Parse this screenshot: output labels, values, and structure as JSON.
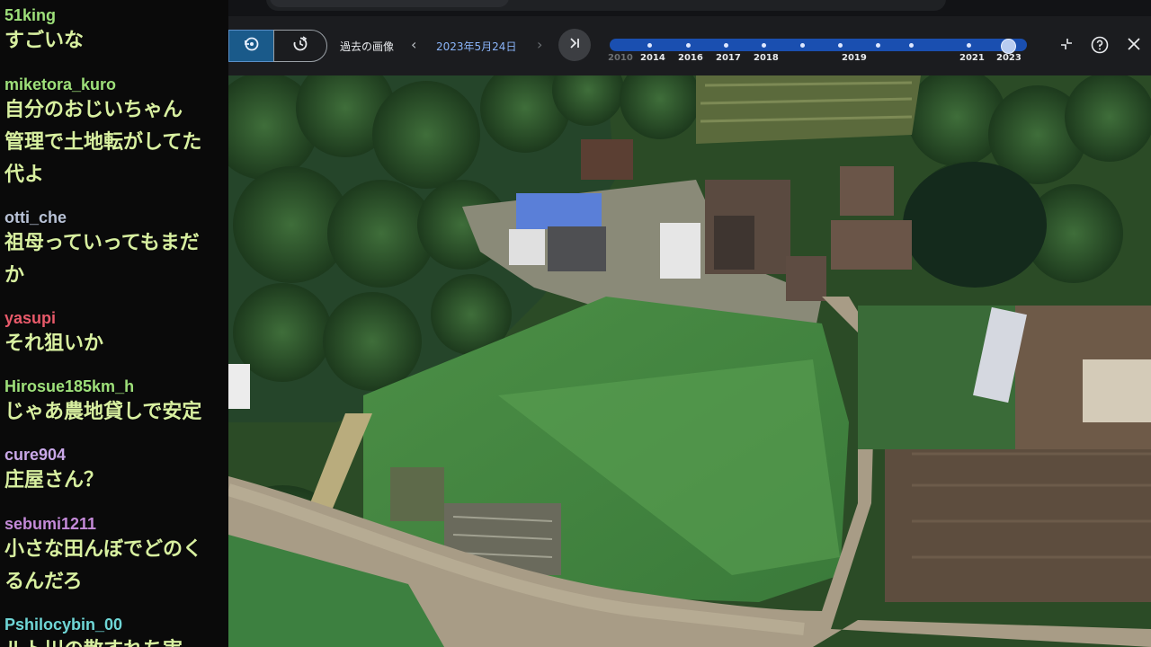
{
  "chat": [
    {
      "user": "51king",
      "user_color": "#9ee07a",
      "lines": [
        "すごいな"
      ]
    },
    {
      "user": "miketora_kuro",
      "user_color": "#9ee07a",
      "lines": [
        "自分のおじいちゃん",
        "管理で土地転がしてた",
        "代よ"
      ]
    },
    {
      "user": "otti_che",
      "user_color": "#b8c2d6",
      "lines": [
        "祖母っていってもまだ",
        "か"
      ]
    },
    {
      "user": "yasupi",
      "user_color": "#e85a6a",
      "lines": [
        "それ狙いか"
      ]
    },
    {
      "user": "Hirosue185km_h",
      "user_color": "#9ee07a",
      "lines": [
        "じゃあ農地貸しで安定"
      ]
    },
    {
      "user": "cure904",
      "user_color": "#c9a8e8",
      "lines": [
        "庄屋さん？"
      ]
    },
    {
      "user": "sebumi1211",
      "user_color": "#c48ad8",
      "lines": [
        "小さな田んぼでどのく",
        "るんだろ"
      ]
    },
    {
      "user": "Pshilocybin_00",
      "user_color": "#6fd6d6",
      "lines": [
        "ルト川の散すれち実"
      ]
    }
  ],
  "history": {
    "past_images_label": "過去の画像",
    "date": "2023年5月24日",
    "years": [
      "2010",
      "2014",
      "2016",
      "2017",
      "2018",
      "2019",
      "2021",
      "2023"
    ],
    "selected_year": "2023"
  },
  "icons": {
    "history_mode": "history-icon",
    "timelapse_mode": "timelapse-icon",
    "prev": "chevron-left-icon",
    "next": "chevron-right-icon",
    "skip": "skip-to-latest-icon",
    "collapse": "collapse-icon",
    "help": "help-icon",
    "close": "close-icon"
  }
}
